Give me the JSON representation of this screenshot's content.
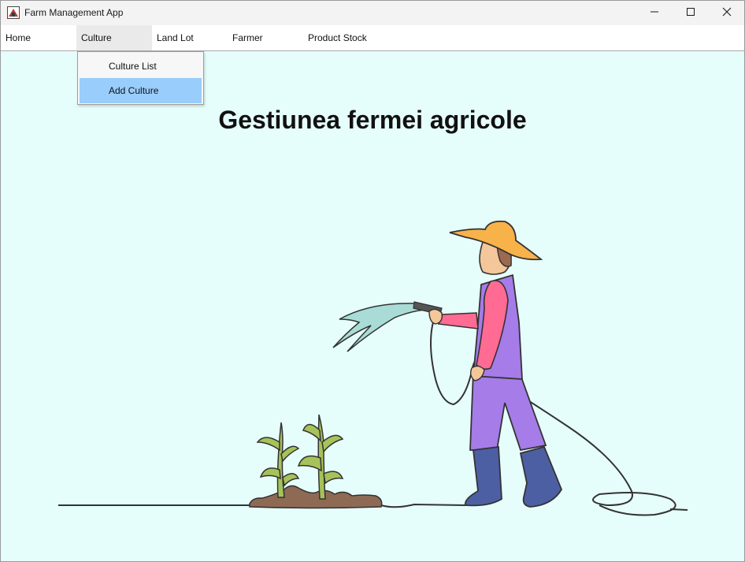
{
  "window": {
    "title": "Farm Management App",
    "icons": {
      "app": "app-icon",
      "minimize": "minimize-icon",
      "maximize": "maximize-icon",
      "close": "close-icon"
    }
  },
  "menu": {
    "items": [
      {
        "label": "Home"
      },
      {
        "label": "Culture",
        "open": true
      },
      {
        "label": "Land Lot"
      },
      {
        "label": "Farmer"
      },
      {
        "label": "Product Stock"
      }
    ],
    "dropdown": [
      {
        "label": "Culture List"
      },
      {
        "label": "Add Culture",
        "highlighted": true
      }
    ]
  },
  "main": {
    "heading": "Gestiunea fermei agricole",
    "illustration": "farmer-watering-plants-illustration"
  },
  "colors": {
    "background": "#e6fefb",
    "menu_highlight": "#99cdfb",
    "hat": "#f7b24a",
    "shirt": "#ff6b93",
    "overalls": "#a57ce8",
    "boots": "#4d5fa3",
    "water": "#a9dcd6",
    "soil": "#8e6a55",
    "plant": "#a6c25a"
  }
}
